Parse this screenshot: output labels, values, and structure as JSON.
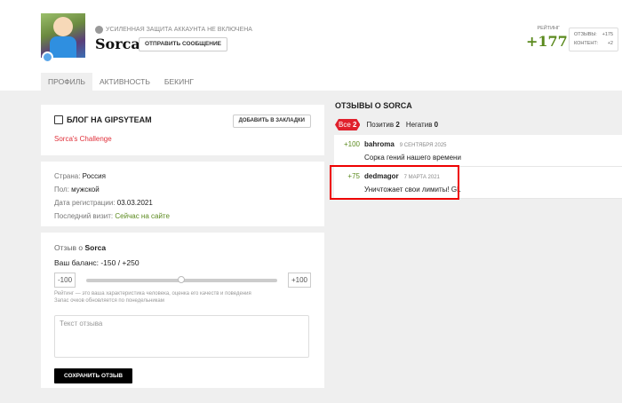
{
  "profile": {
    "name": "Sorca",
    "security_notice": "УСИЛЕННАЯ ЗАЩИТА АККАУНТА НЕ ВКЛЮЧЕНА",
    "send_message": "ОТПРАВИТЬ СООБЩЕНИЕ"
  },
  "rating": {
    "label": "РЕЙТИНГ",
    "value": "+177",
    "reviews_label": "ОТЗЫВЫ:",
    "reviews_value": "+175",
    "content_label": "КОНТЕНТ:",
    "content_value": "+2"
  },
  "tabs": [
    {
      "label": "ПРОФИЛЬ",
      "active": true
    },
    {
      "label": "АКТИВНОСТЬ"
    },
    {
      "label": "БЕКИНГ"
    }
  ],
  "blog": {
    "title": "БЛОГ НА GIPSYTEAM",
    "bookmark": "ДОБАВИТЬ В ЗАКЛАДКИ",
    "link": "Sorca's Challenge"
  },
  "info": {
    "country_label": "Страна:",
    "country": "Россия",
    "gender_label": "Пол:",
    "gender": "мужской",
    "reg_label": "Дата регистрации:",
    "reg": "03.03.2021",
    "visit_label": "Последний визит:",
    "visit": "Сейчас на сайте"
  },
  "review_form": {
    "title_prefix": "Отзыв о",
    "title_name": "Sorca",
    "balance": "Ваш баланс: -150 / +250",
    "min": "-100",
    "max": "+100",
    "slider_value": 0,
    "hint1": "Рейтинг — это ваша характеристика человека, оценка его качеств и поведения",
    "hint2": "Запас очков обновляется по понедельникам",
    "placeholder": "Текст отзыва",
    "save": "СОХРАНИТЬ ОТЗЫВ"
  },
  "reviews": {
    "title": "ОТЗЫВЫ О SORCA",
    "filters": [
      {
        "label": "Все",
        "count": "2"
      },
      {
        "label": "Позитив",
        "count": "2"
      },
      {
        "label": "Негатив",
        "count": "0"
      }
    ],
    "items": [
      {
        "points": "+100",
        "author": "bahroma",
        "date": "9 СЕНТЯБРЯ 2025",
        "text": "Сорка гений нашего времени"
      },
      {
        "points": "+75",
        "author": "dedmagor",
        "date": "7 МАРТА 2021",
        "text": "Уничтожает свои лимиты! GL"
      }
    ]
  },
  "colors": {
    "accent": "#e0202c",
    "positive": "#5b8a1e",
    "highlight": "#ee0000"
  }
}
